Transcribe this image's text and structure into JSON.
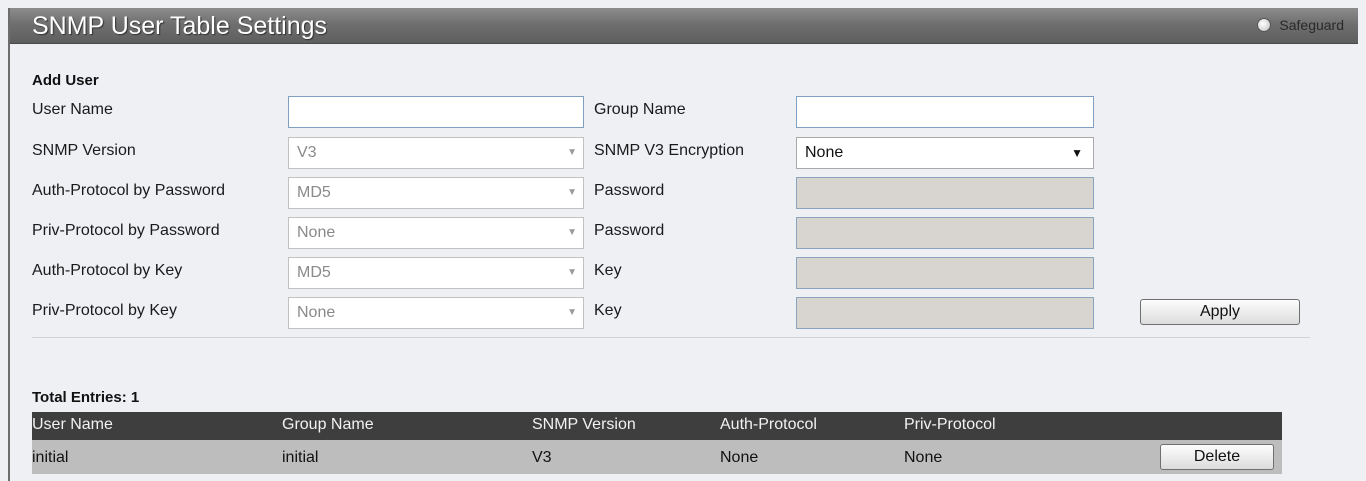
{
  "window": {
    "title": "SNMP User Table Settings",
    "safeguard_label": "Safeguard"
  },
  "add_user": {
    "section_title": "Add User",
    "labels": {
      "user_name": "User Name",
      "group_name": "Group Name",
      "snmp_version": "SNMP Version",
      "snmp_v3_encryption": "SNMP V3 Encryption",
      "auth_protocol_password": "Auth-Protocol by Password",
      "password_1": "Password",
      "priv_protocol_password": "Priv-Protocol by Password",
      "password_2": "Password",
      "auth_protocol_key": "Auth-Protocol by Key",
      "key_1": "Key",
      "priv_protocol_key": "Priv-Protocol by Key",
      "key_2": "Key"
    },
    "values": {
      "user_name": "",
      "group_name": "",
      "snmp_version": "V3",
      "snmp_v3_encryption": "None",
      "auth_protocol_password": "MD5",
      "priv_protocol_password": "None",
      "auth_protocol_key": "MD5",
      "priv_protocol_key": "None",
      "password_1": "",
      "password_2": "",
      "key_1": "",
      "key_2": ""
    },
    "apply_label": "Apply"
  },
  "table": {
    "total_entries_label": "Total Entries: 1",
    "columns": [
      "User Name",
      "Group Name",
      "SNMP Version",
      "Auth-Protocol",
      "Priv-Protocol"
    ],
    "rows": [
      {
        "user_name": "initial",
        "group_name": "initial",
        "snmp_version": "V3",
        "auth_protocol": "None",
        "priv_protocol": "None",
        "delete_label": "Delete"
      }
    ]
  },
  "colors": {
    "title_bar": "#6f6f6f",
    "table_header": "#3e3e3e",
    "table_row": "#bdbdbd",
    "disabled_field": "#d8d4cf"
  }
}
